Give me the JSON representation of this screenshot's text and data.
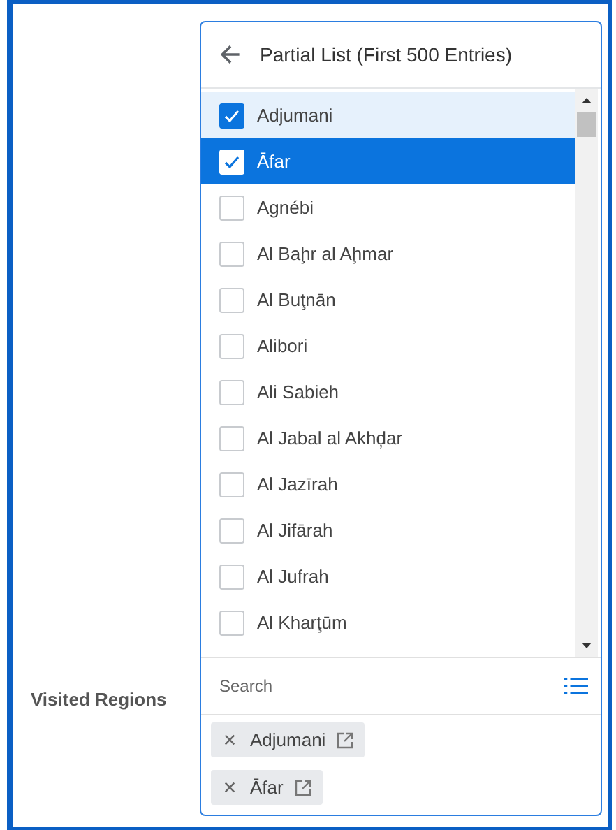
{
  "field": {
    "label": "Visited Regions"
  },
  "picker": {
    "title": "Partial List (First 500 Entries)",
    "options": [
      {
        "label": "Adjumani",
        "checked": true,
        "selected": false,
        "hovered": true
      },
      {
        "label": "Āfar",
        "checked": true,
        "selected": true,
        "hovered": false
      },
      {
        "label": "Agnébi",
        "checked": false,
        "selected": false,
        "hovered": false
      },
      {
        "label": "Al Baḩr al Aḩmar",
        "checked": false,
        "selected": false,
        "hovered": false
      },
      {
        "label": "Al Buţnān",
        "checked": false,
        "selected": false,
        "hovered": false
      },
      {
        "label": "Alibori",
        "checked": false,
        "selected": false,
        "hovered": false
      },
      {
        "label": "Ali Sabieh",
        "checked": false,
        "selected": false,
        "hovered": false
      },
      {
        "label": "Al Jabal al Akhḑar",
        "checked": false,
        "selected": false,
        "hovered": false
      },
      {
        "label": "Al Jazīrah",
        "checked": false,
        "selected": false,
        "hovered": false
      },
      {
        "label": "Al Jifārah",
        "checked": false,
        "selected": false,
        "hovered": false
      },
      {
        "label": "Al Jufrah",
        "checked": false,
        "selected": false,
        "hovered": false
      },
      {
        "label": "Al Kharţūm",
        "checked": false,
        "selected": false,
        "hovered": false
      }
    ],
    "search": {
      "placeholder": "Search"
    },
    "chips": [
      {
        "label": "Adjumani"
      },
      {
        "label": "Āfar"
      }
    ]
  }
}
